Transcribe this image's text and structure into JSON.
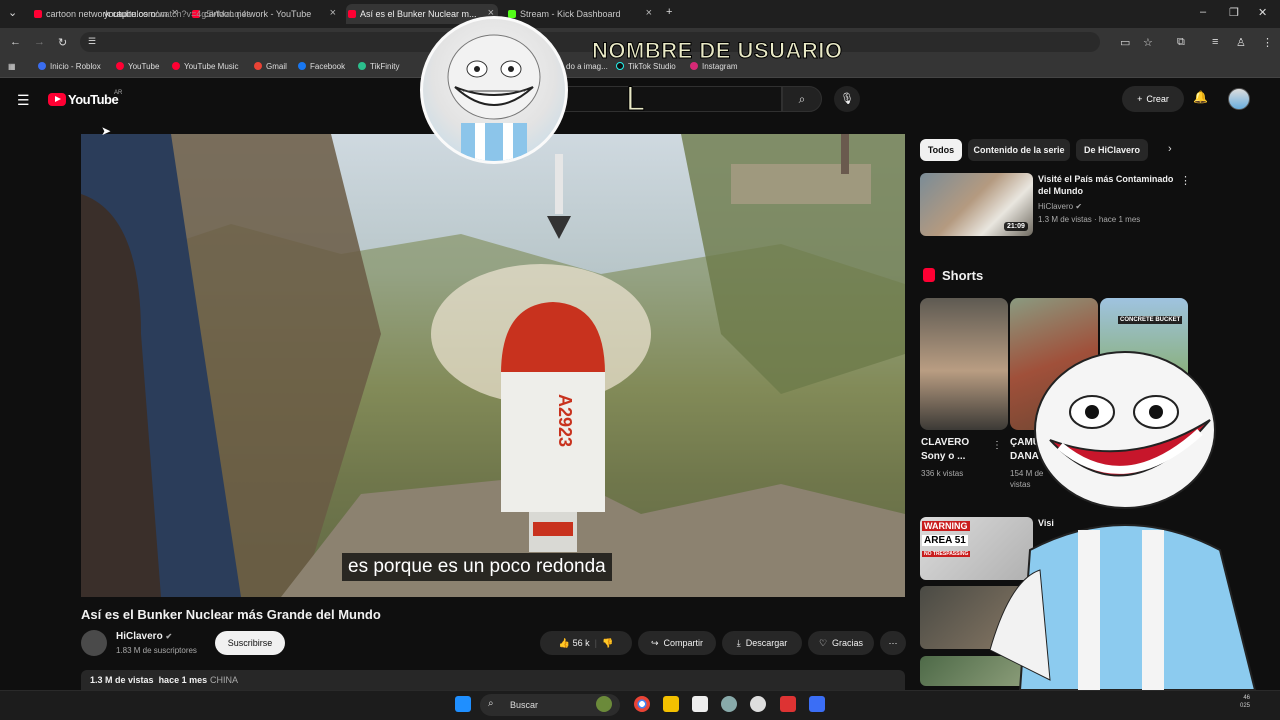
{
  "browser": {
    "tabs": [
      {
        "title": "cartoon network capitulos com..."
      },
      {
        "title": "cartoon network - YouTube"
      },
      {
        "title": "Así es el Bunker Nuclear m..."
      },
      {
        "title": "Stream - Kick Dashboard"
      }
    ],
    "url_host": "youtube.com",
    "url_path": "/watch?v=4g5VMzLqi4s",
    "bookmarks": [
      "Inicio - Roblox",
      "YouTube",
      "YouTube Music",
      "Gmail",
      "Facebook",
      "TikFinity",
      "do a imag...",
      "TikTok Studio",
      "Instagram"
    ]
  },
  "youtube": {
    "logo_text": "YouTube",
    "region": "AR",
    "create_label": "Crear"
  },
  "video": {
    "subtitle": "es porque es un poco redonda",
    "title": "Así es el Bunker Nuclear más Grande del Mundo",
    "channel": "HiClavero",
    "subscribers": "1.83 M de suscriptores",
    "subscribe_label": "Suscribirse",
    "likes": "56 k",
    "share_label": "Compartir",
    "download_label": "Descargar",
    "thanks_label": "Gracias",
    "views": "1.3 M de vistas",
    "age": "hace 1 mes",
    "tag": "CHINA",
    "rocket_text": "A2923"
  },
  "sidebar": {
    "chips": [
      "Todos",
      "Contenido de la serie",
      "De HiClavero"
    ],
    "recommended": {
      "title": "Visité el País más Contaminado del Mundo",
      "channel": "HiClavero",
      "meta": "1.3 M de vistas · hace 1 mes",
      "duration": "21:09"
    },
    "shorts_label": "Shorts",
    "shorts": [
      {
        "title": "CLAVERO Sony o ...",
        "meta": "336 k vistas"
      },
      {
        "title": "ÇAMUR DANA ...",
        "meta": "154 M de vistas"
      },
      {
        "title": "",
        "meta": "",
        "thumb_text": "CONCRETE BUCKET"
      }
    ],
    "more_thumb_text": [
      "WARNING",
      "AREA 51",
      "NO TRESPASSING"
    ],
    "more_title_fragment": "Visi"
  },
  "overlay": {
    "username": "NOMBRE DE USUARIO",
    "letter": "L"
  },
  "taskbar": {
    "search_label": "Buscar",
    "clock_line1": "46",
    "clock_line2": "025"
  }
}
